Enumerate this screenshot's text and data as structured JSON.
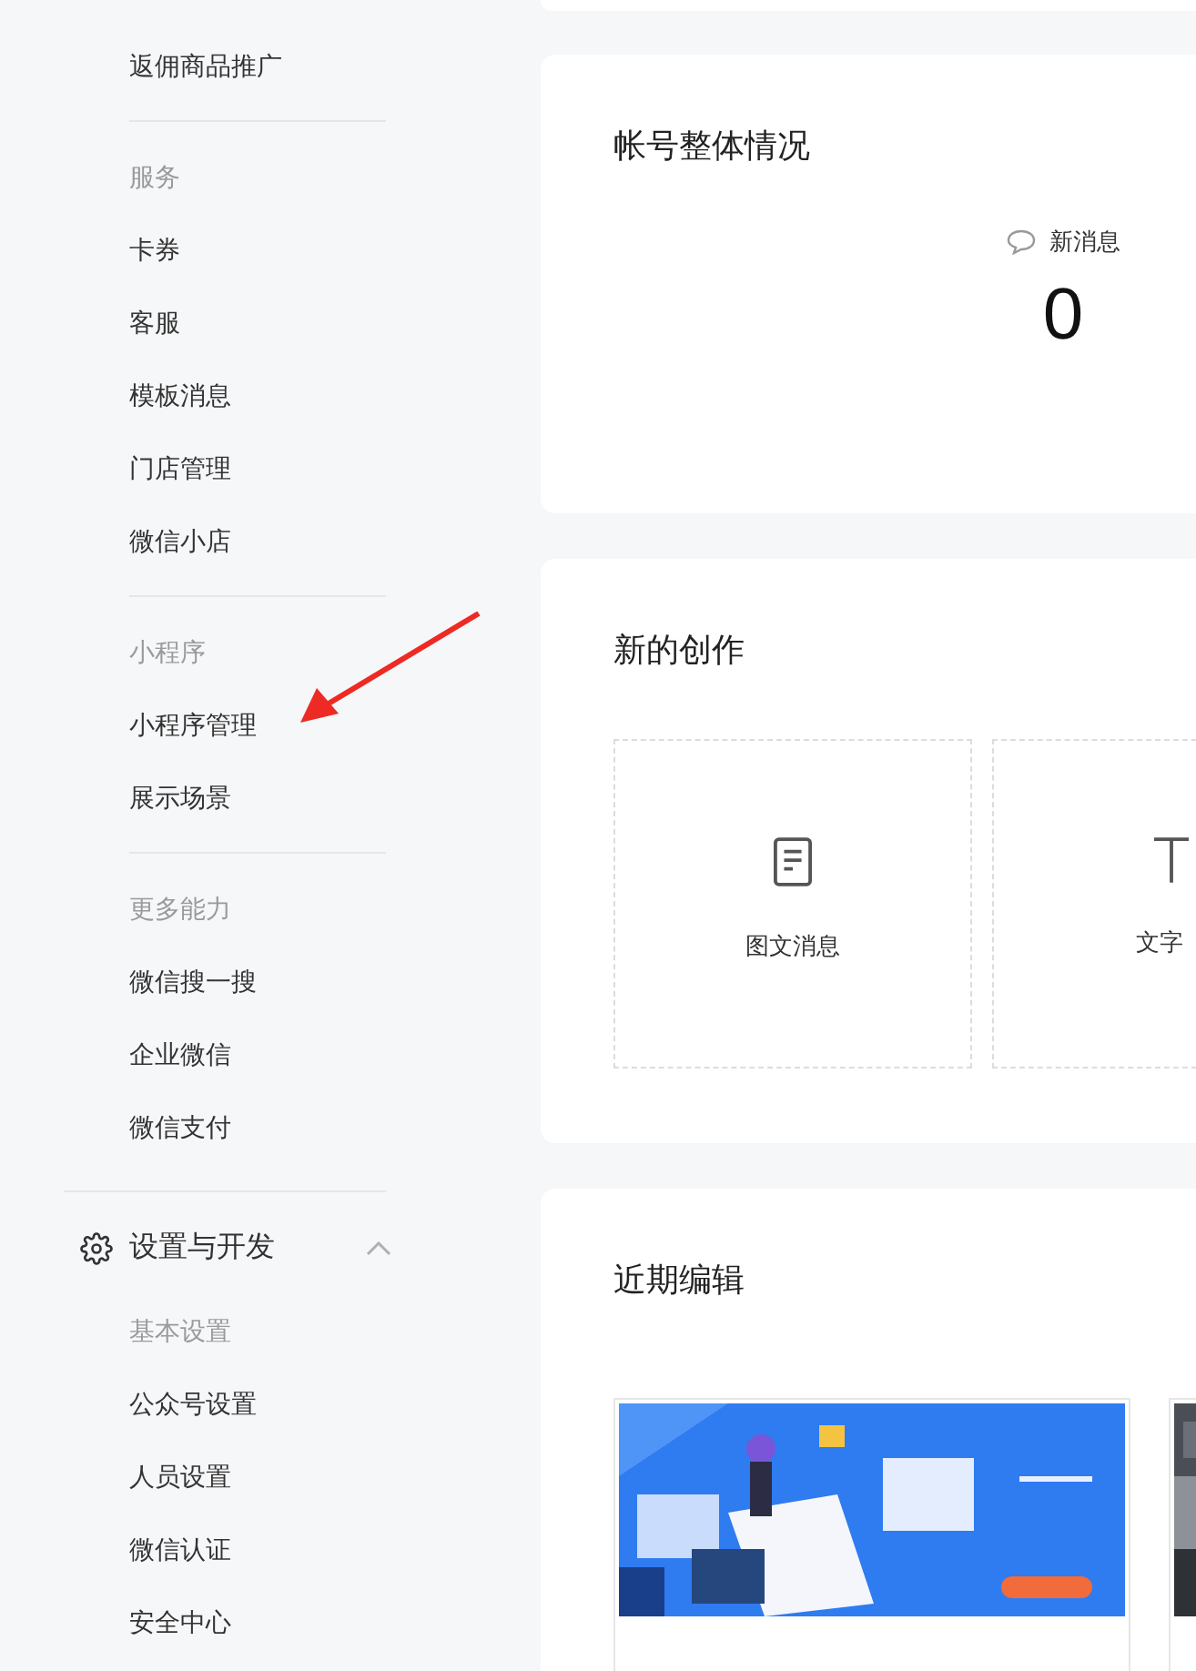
{
  "sidebar": {
    "sections": [
      {
        "items": [
          "返佣商品推广"
        ]
      },
      {
        "header": "服务",
        "items": [
          "卡券",
          "客服",
          "模板消息",
          "门店管理",
          "微信小店"
        ]
      },
      {
        "header": "小程序",
        "items": [
          "小程序管理",
          "展示场景"
        ]
      },
      {
        "header": "更多能力",
        "items": [
          "微信搜一搜",
          "企业微信",
          "微信支付"
        ]
      }
    ],
    "groups": [
      {
        "title": "设置与开发",
        "expanded": true,
        "sections": [
          {
            "header": "基本设置",
            "items": [
              "公众号设置",
              "人员设置",
              "微信认证",
              "安全中心"
            ]
          }
        ]
      }
    ]
  },
  "overview": {
    "title": "帐号整体情况",
    "stats": [
      {
        "label": "新消息",
        "value": "0"
      }
    ]
  },
  "create": {
    "title": "新的创作",
    "options": [
      {
        "kind": "article",
        "label": "图文消息"
      },
      {
        "kind": "text",
        "label": "文字"
      }
    ]
  },
  "recent": {
    "title": "近期编辑"
  }
}
